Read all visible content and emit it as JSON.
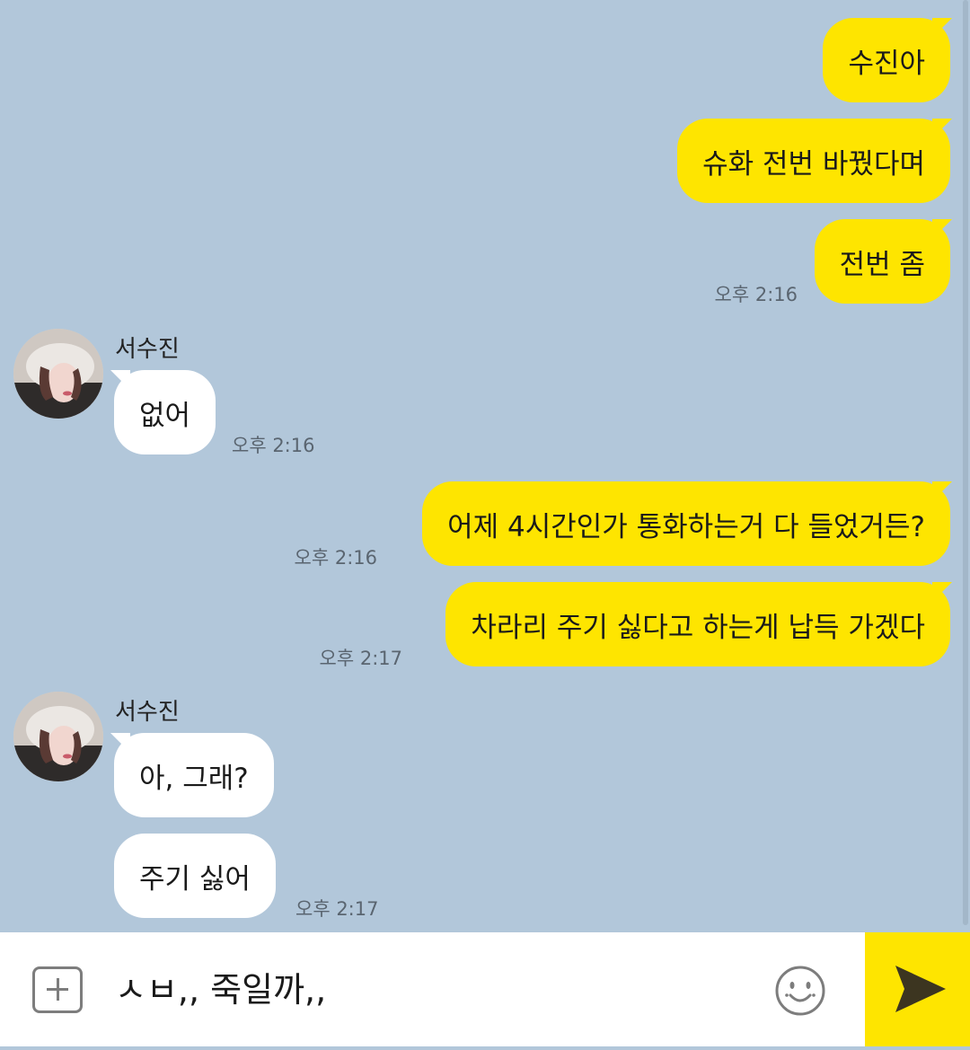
{
  "colors": {
    "chat_background": "#b2c7da",
    "my_bubble": "#fee500",
    "their_bubble": "#ffffff",
    "send_button": "#fee500",
    "timestamp": "#5a6570"
  },
  "messages": [
    {
      "side": "me",
      "text": "수진아",
      "time": ""
    },
    {
      "side": "me",
      "text": "슈화 전번 바꿨다며",
      "time": ""
    },
    {
      "side": "me",
      "text": "전번 좀",
      "time": "오후 2:16"
    },
    {
      "side": "them",
      "sender": "서수진",
      "text": "없어",
      "time": "오후 2:16"
    },
    {
      "side": "me",
      "text": "어제 4시간인가 통화하는거 다 들었거든?",
      "time": "오후 2:16"
    },
    {
      "side": "me",
      "text": "차라리 주기 싫다고 하는게 납득 가겠다",
      "time": "오후 2:17"
    },
    {
      "side": "them",
      "sender": "서수진",
      "text": "아, 그래?",
      "time": ""
    },
    {
      "side": "them",
      "text": "주기 싫어",
      "time": "오후 2:17"
    }
  ],
  "input": {
    "value": "ㅅㅂ,, 죽일까,,",
    "attach_icon": "plus-square-icon",
    "emoji_icon": "smiley-icon",
    "send_icon": "send-arrow-icon"
  }
}
